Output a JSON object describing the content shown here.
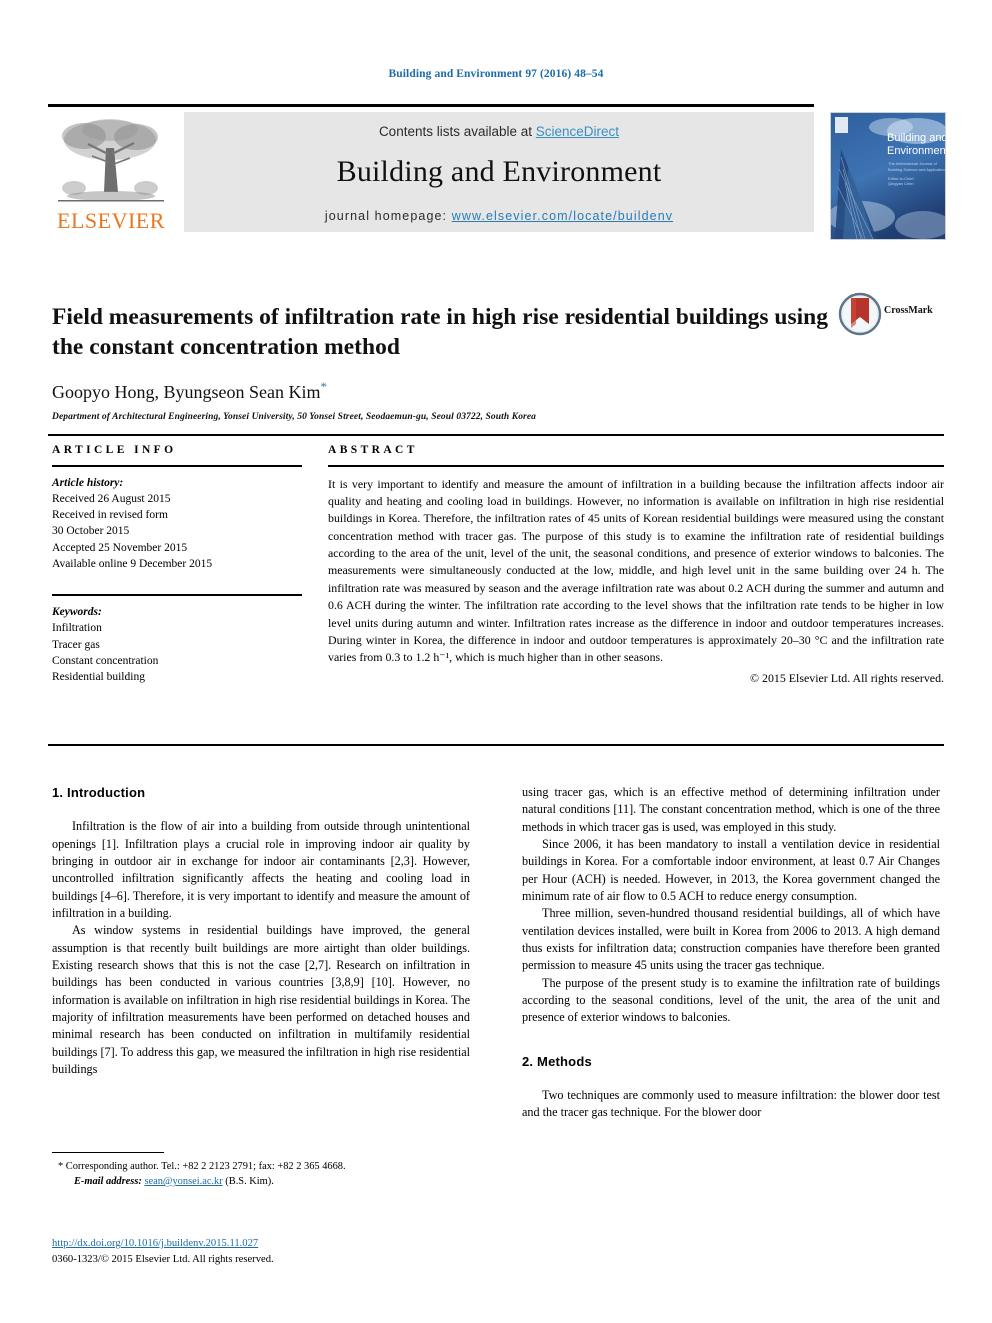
{
  "running_head": "Building and Environment 97 (2016) 48–54",
  "masthead": {
    "contents_prefix": "Contents lists available at ",
    "sciencedirect": "ScienceDirect",
    "journal_title": "Building and Environment",
    "homepage_prefix": "journal homepage: ",
    "homepage_url": "www.elsevier.com/locate/buildenv",
    "publisher": "ELSEVIER",
    "cover_title_line1": "Building and",
    "cover_title_line2": "Environment"
  },
  "article": {
    "title": "Field measurements of infiltration rate in high rise residential buildings using the constant concentration method",
    "authors": "Goopyo Hong, Byungseon Sean Kim",
    "corresponding_marker": "*",
    "affiliation": "Department of Architectural Engineering, Yonsei University, 50 Yonsei Street, Seodaemun-gu, Seoul 03722, South Korea",
    "crossmark_label": "CrossMark"
  },
  "article_info": {
    "heading": "ARTICLE INFO",
    "history_label": "Article history:",
    "history": [
      "Received 26 August 2015",
      "Received in revised form",
      "30 October 2015",
      "Accepted 25 November 2015",
      "Available online 9 December 2015"
    ],
    "keywords_label": "Keywords:",
    "keywords": [
      "Infiltration",
      "Tracer gas",
      "Constant concentration",
      "Residential building"
    ]
  },
  "abstract": {
    "heading": "ABSTRACT",
    "text": "It is very important to identify and measure the amount of infiltration in a building because the infiltration affects indoor air quality and heating and cooling load in buildings. However, no information is available on infiltration in high rise residential buildings in Korea. Therefore, the infiltration rates of 45 units of Korean residential buildings were measured using the constant concentration method with tracer gas. The purpose of this study is to examine the infiltration rate of residential buildings according to the area of the unit, level of the unit, the seasonal conditions, and presence of exterior windows to balconies. The measurements were simultaneously conducted at the low, middle, and high level unit in the same building over 24 h. The infiltration rate was measured by season and the average infiltration rate was about 0.2 ACH during the summer and autumn and 0.6 ACH during the winter. The infiltration rate according to the level shows that the infiltration rate tends to be higher in low level units during autumn and winter. Infiltration rates increase as the difference in indoor and outdoor temperatures increases. During winter in Korea, the difference in indoor and outdoor temperatures is approximately 20–30 °C and the infiltration rate varies from 0.3 to 1.2 h⁻¹, which is much higher than in other seasons.",
    "copyright": "© 2015 Elsevier Ltd. All rights reserved."
  },
  "body": {
    "section1_heading": "1. Introduction",
    "section2_heading": "2. Methods",
    "left_paragraphs": [
      "Infiltration is the flow of air into a building from outside through unintentional openings [1]. Infiltration plays a crucial role in improving indoor air quality by bringing in outdoor air in exchange for indoor air contaminants [2,3]. However, uncontrolled infiltration significantly affects the heating and cooling load in buildings [4–6]. Therefore, it is very important to identify and measure the amount of infiltration in a building.",
      "As window systems in residential buildings have improved, the general assumption is that recently built buildings are more airtight than older buildings. Existing research shows that this is not the case [2,7]. Research on infiltration in buildings has been conducted in various countries [3,8,9] [10]. However, no information is available on infiltration in high rise residential buildings in Korea. The majority of infiltration measurements have been performed on detached houses and minimal research has been conducted on infiltration in multifamily residential buildings [7]. To address this gap, we measured the infiltration in high rise residential buildings"
    ],
    "right_paragraphs": [
      "using tracer gas, which is an effective method of determining infiltration under natural conditions [11]. The constant concentration method, which is one of the three methods in which tracer gas is used, was employed in this study.",
      "Since 2006, it has been mandatory to install a ventilation device in residential buildings in Korea. For a comfortable indoor environment, at least 0.7 Air Changes per Hour (ACH) is needed. However, in 2013, the Korea government changed the minimum rate of air flow to 0.5 ACH to reduce energy consumption.",
      "Three million, seven-hundred thousand residential buildings, all of which have ventilation devices installed, were built in Korea from 2006 to 2013. A high demand thus exists for infiltration data; construction companies have therefore been granted permission to measure 45 units using the tracer gas technique.",
      "The purpose of the present study is to examine the infiltration rate of buildings according to the seasonal conditions, level of the unit, the area of the unit and presence of exterior windows to balconies."
    ],
    "methods_paragraph": "Two techniques are commonly used to measure infiltration: the blower door test and the tracer gas technique. For the blower door"
  },
  "footnotes": {
    "corresponding": "* Corresponding author. Tel.: +82 2 2123 2791; fax: +82 2 365 4668.",
    "email_label": "E-mail address:",
    "email": "sean@yonsei.ac.kr",
    "email_suffix": "(B.S. Kim).",
    "doi": "http://dx.doi.org/10.1016/j.buildenv.2015.11.027",
    "issn_copyright": "0360-1323/© 2015 Elsevier Ltd. All rights reserved."
  },
  "colors": {
    "link_blue": "#1c6ca8",
    "elsevier_orange": "#E87722",
    "band_gray": "#e6e6e6"
  }
}
